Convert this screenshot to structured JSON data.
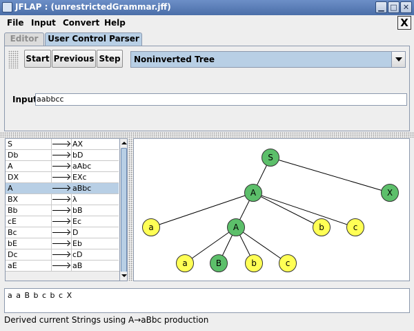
{
  "window": {
    "title": "JFLAP : (unrestrictedGrammar.jff)",
    "minimize": "▁",
    "maximize": "□",
    "close": "✕"
  },
  "menubar": {
    "items": [
      "File",
      "Input",
      "Convert",
      "Help"
    ],
    "close_label": "X"
  },
  "tabs": [
    {
      "label": "Editor",
      "active": false
    },
    {
      "label": "User Control Parser",
      "active": true
    }
  ],
  "toolbar": {
    "start_label": "Start",
    "previous_label": "Previous",
    "step_label": "Step",
    "view_select": {
      "selected": "Noninverted Tree"
    }
  },
  "input": {
    "label": "Input",
    "value": "aabbcc"
  },
  "grammar": {
    "selected_row": 4,
    "productions": [
      {
        "lhs": "S",
        "rhs": "AX"
      },
      {
        "lhs": "Db",
        "rhs": "bD"
      },
      {
        "lhs": "A",
        "rhs": "aAbc"
      },
      {
        "lhs": "DX",
        "rhs": "EXc"
      },
      {
        "lhs": "A",
        "rhs": "aBbc"
      },
      {
        "lhs": "BX",
        "rhs": "λ"
      },
      {
        "lhs": "Bb",
        "rhs": "bB"
      },
      {
        "lhs": "cE",
        "rhs": "Ec"
      },
      {
        "lhs": "Bc",
        "rhs": "D"
      },
      {
        "lhs": "bE",
        "rhs": "Eb"
      },
      {
        "lhs": "Dc",
        "rhs": "cD"
      },
      {
        "lhs": "aE",
        "rhs": "aB"
      }
    ]
  },
  "tree": {
    "colors": {
      "variable": "#5cbf6a",
      "terminal": "#ffff55",
      "stroke": "#333333"
    },
    "nodes": [
      {
        "id": "n1",
        "label": "S",
        "kind": "variable"
      },
      {
        "id": "n2",
        "label": "A",
        "kind": "variable"
      },
      {
        "id": "n3",
        "label": "X",
        "kind": "variable"
      },
      {
        "id": "n4",
        "label": "a",
        "kind": "terminal"
      },
      {
        "id": "n5",
        "label": "A",
        "kind": "variable"
      },
      {
        "id": "n6",
        "label": "b",
        "kind": "terminal"
      },
      {
        "id": "n7",
        "label": "c",
        "kind": "terminal"
      },
      {
        "id": "n8",
        "label": "a",
        "kind": "terminal"
      },
      {
        "id": "n9",
        "label": "B",
        "kind": "variable"
      },
      {
        "id": "n10",
        "label": "b",
        "kind": "terminal"
      },
      {
        "id": "n11",
        "label": "c",
        "kind": "terminal"
      }
    ]
  },
  "derivation": {
    "text": "a a B b c b c X"
  },
  "status": {
    "text": "Derived current Strings using A→aBbc production"
  }
}
